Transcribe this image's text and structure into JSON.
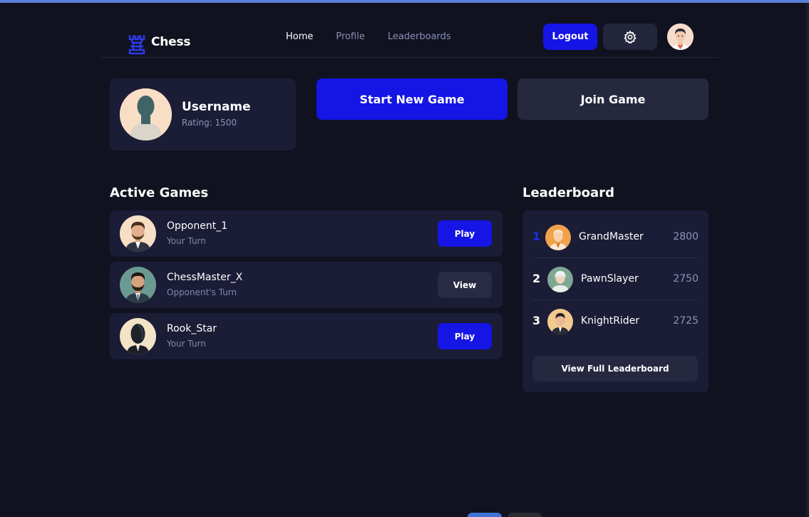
{
  "app": {
    "name": "Chess",
    "logo_icon": "chess-rook-icon",
    "accent_color": "#1515e6"
  },
  "nav": {
    "items": [
      {
        "label": "Home",
        "active": true
      },
      {
        "label": "Profile",
        "active": false
      },
      {
        "label": "Leaderboards",
        "active": false
      }
    ],
    "logout_label": "Logout",
    "settings_icon": "gear-icon"
  },
  "profile": {
    "username": "Username",
    "rating": "Rating: 1500"
  },
  "actions": {
    "start_new_game": "Start New Game",
    "join_game": "Join Game"
  },
  "active_games": {
    "title": "Active Games",
    "games": [
      {
        "opponent": "Opponent_1",
        "status": "Your Turn",
        "action": "Play"
      },
      {
        "opponent": "ChessMaster_X",
        "status": "Opponent's Turn",
        "action": "View"
      },
      {
        "opponent": "Rook_Star",
        "status": "Your Turn",
        "action": "Play"
      }
    ]
  },
  "leaderboard": {
    "title": "Leaderboard",
    "entries": [
      {
        "rank": "1",
        "name": "GrandMaster",
        "score": "2800"
      },
      {
        "rank": "2",
        "name": "PawnSlayer",
        "score": "2750"
      },
      {
        "rank": "3",
        "name": "KnightRider",
        "score": "2725"
      }
    ],
    "view_full_label": "View Full Leaderboard"
  }
}
